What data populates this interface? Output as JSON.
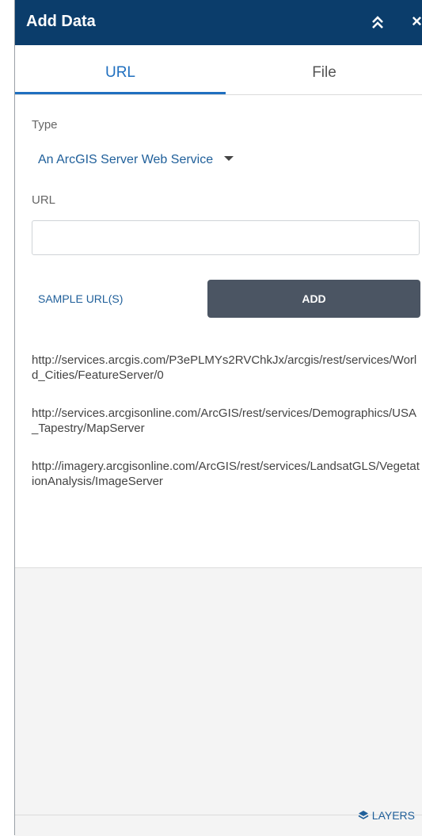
{
  "header": {
    "title": "Add Data",
    "close_glyph": "×"
  },
  "tabs": [
    {
      "label": "URL",
      "active": true
    },
    {
      "label": "File",
      "active": false
    }
  ],
  "form": {
    "type_label": "Type",
    "type_value": "An ArcGIS Server Web Service",
    "url_label": "URL",
    "url_value": "",
    "url_placeholder": ""
  },
  "actions": {
    "sample_label": "SAMPLE URL(S)",
    "add_label": "ADD"
  },
  "samples": [
    "http://services.arcgis.com/P3ePLMYs2RVChkJx/arcgis/rest/services/World_Cities/FeatureServer/0",
    "http://services.arcgisonline.com/ArcGIS/rest/services/Demographics/USA_Tapestry/MapServer",
    "http://imagery.arcgisonline.com/ArcGIS/rest/services/LandsatGLS/VegetationAnalysis/ImageServer"
  ],
  "footer": {
    "layers_label": "LAYERS"
  },
  "colors": {
    "header": "#0b3d6b",
    "accent": "#1f6fbf",
    "add_button": "#4b5563"
  },
  "icons": {
    "collapse": "double-chevron-up-icon",
    "close": "close-icon",
    "layers": "layers-icon",
    "dropdown": "caret-down-icon"
  }
}
